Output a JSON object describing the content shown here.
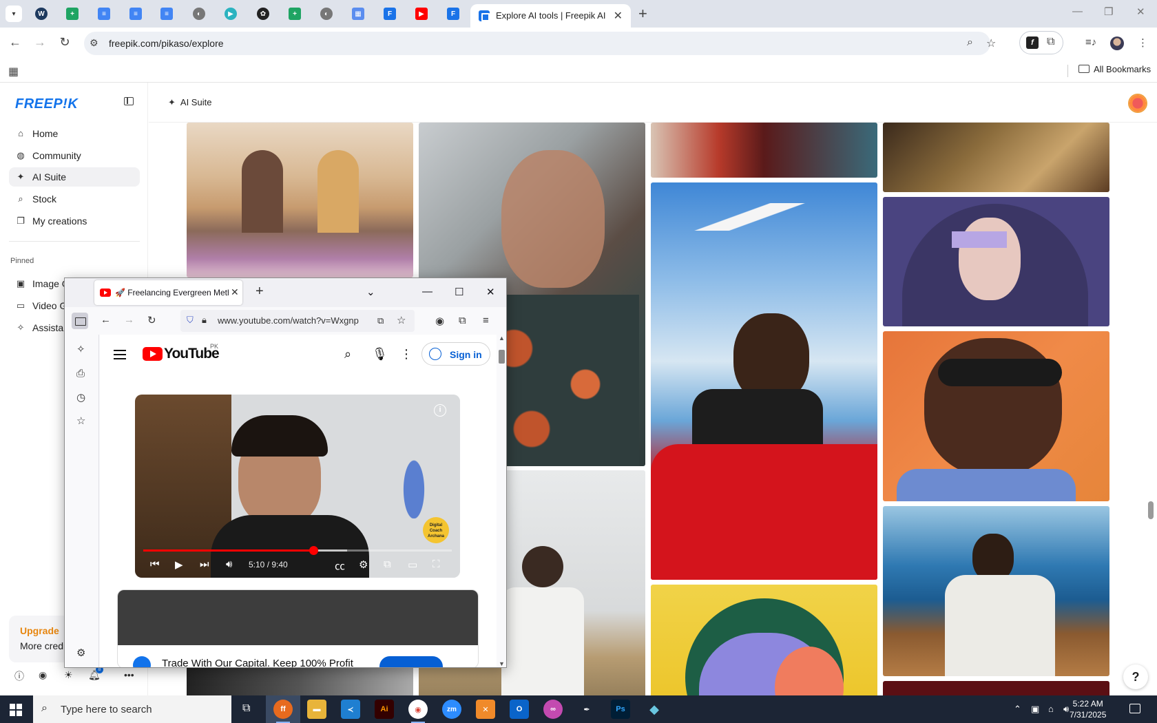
{
  "chrome": {
    "active_tab_title": "Explore AI tools | Freepik AI",
    "url": "freepik.com/pikaso/explore",
    "all_bookmarks": "All Bookmarks"
  },
  "freepik": {
    "logo": "FREEP!K",
    "nav": [
      "Home",
      "Community",
      "AI Suite",
      "Stock",
      "My creations"
    ],
    "pinned_label": "Pinned",
    "pinned": [
      "Image G",
      "Video G",
      "Assistan"
    ],
    "upgrade": "Upgrade",
    "more_credits": "More credi",
    "header_ai_suite": "AI Suite",
    "notification_count": "8",
    "help": "?"
  },
  "firefox": {
    "tab_title": "🚀 Freelancing Evergreen Meth",
    "url": "www.youtube.com/watch?v=Wxgnp"
  },
  "youtube": {
    "wordmark": "YouTube",
    "region": "PK",
    "sign_in": "Sign in",
    "time": "5:10 / 9:40",
    "progress": 0.5517,
    "buffered": 0.66,
    "watermark": "Digital Coach Archana",
    "ad_text": "Trade With Our Capital. Keep 100% Profit"
  },
  "taskbar": {
    "search_placeholder": "Type here to search",
    "time": "5:22 AM",
    "date": "7/31/2025"
  },
  "colors": {
    "freepik_blue": "#1273eb",
    "upgrade_orange": "#e7860f",
    "youtube_red": "#ff0000",
    "youtube_blue": "#065fd4"
  }
}
